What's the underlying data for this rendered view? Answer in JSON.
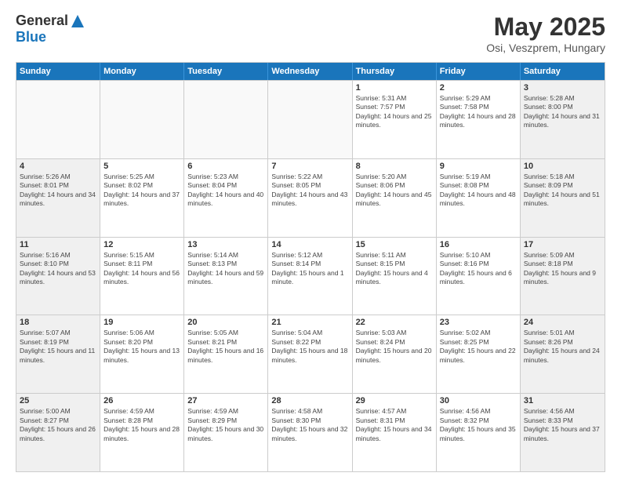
{
  "header": {
    "logo_general": "General",
    "logo_blue": "Blue",
    "month_title": "May 2025",
    "subtitle": "Osi, Veszprem, Hungary"
  },
  "days_of_week": [
    "Sunday",
    "Monday",
    "Tuesday",
    "Wednesday",
    "Thursday",
    "Friday",
    "Saturday"
  ],
  "rows": [
    {
      "cells": [
        {
          "day": "",
          "empty": true
        },
        {
          "day": "",
          "empty": true
        },
        {
          "day": "",
          "empty": true
        },
        {
          "day": "",
          "empty": true
        },
        {
          "day": "1",
          "sunrise": "Sunrise: 5:31 AM",
          "sunset": "Sunset: 7:57 PM",
          "daylight": "Daylight: 14 hours and 25 minutes."
        },
        {
          "day": "2",
          "sunrise": "Sunrise: 5:29 AM",
          "sunset": "Sunset: 7:58 PM",
          "daylight": "Daylight: 14 hours and 28 minutes."
        },
        {
          "day": "3",
          "sunrise": "Sunrise: 5:28 AM",
          "sunset": "Sunset: 8:00 PM",
          "daylight": "Daylight: 14 hours and 31 minutes.",
          "shaded": true
        }
      ]
    },
    {
      "cells": [
        {
          "day": "4",
          "sunrise": "Sunrise: 5:26 AM",
          "sunset": "Sunset: 8:01 PM",
          "daylight": "Daylight: 14 hours and 34 minutes.",
          "shaded": true
        },
        {
          "day": "5",
          "sunrise": "Sunrise: 5:25 AM",
          "sunset": "Sunset: 8:02 PM",
          "daylight": "Daylight: 14 hours and 37 minutes."
        },
        {
          "day": "6",
          "sunrise": "Sunrise: 5:23 AM",
          "sunset": "Sunset: 8:04 PM",
          "daylight": "Daylight: 14 hours and 40 minutes."
        },
        {
          "day": "7",
          "sunrise": "Sunrise: 5:22 AM",
          "sunset": "Sunset: 8:05 PM",
          "daylight": "Daylight: 14 hours and 43 minutes."
        },
        {
          "day": "8",
          "sunrise": "Sunrise: 5:20 AM",
          "sunset": "Sunset: 8:06 PM",
          "daylight": "Daylight: 14 hours and 45 minutes."
        },
        {
          "day": "9",
          "sunrise": "Sunrise: 5:19 AM",
          "sunset": "Sunset: 8:08 PM",
          "daylight": "Daylight: 14 hours and 48 minutes."
        },
        {
          "day": "10",
          "sunrise": "Sunrise: 5:18 AM",
          "sunset": "Sunset: 8:09 PM",
          "daylight": "Daylight: 14 hours and 51 minutes.",
          "shaded": true
        }
      ]
    },
    {
      "cells": [
        {
          "day": "11",
          "sunrise": "Sunrise: 5:16 AM",
          "sunset": "Sunset: 8:10 PM",
          "daylight": "Daylight: 14 hours and 53 minutes.",
          "shaded": true
        },
        {
          "day": "12",
          "sunrise": "Sunrise: 5:15 AM",
          "sunset": "Sunset: 8:11 PM",
          "daylight": "Daylight: 14 hours and 56 minutes."
        },
        {
          "day": "13",
          "sunrise": "Sunrise: 5:14 AM",
          "sunset": "Sunset: 8:13 PM",
          "daylight": "Daylight: 14 hours and 59 minutes."
        },
        {
          "day": "14",
          "sunrise": "Sunrise: 5:12 AM",
          "sunset": "Sunset: 8:14 PM",
          "daylight": "Daylight: 15 hours and 1 minute."
        },
        {
          "day": "15",
          "sunrise": "Sunrise: 5:11 AM",
          "sunset": "Sunset: 8:15 PM",
          "daylight": "Daylight: 15 hours and 4 minutes."
        },
        {
          "day": "16",
          "sunrise": "Sunrise: 5:10 AM",
          "sunset": "Sunset: 8:16 PM",
          "daylight": "Daylight: 15 hours and 6 minutes."
        },
        {
          "day": "17",
          "sunrise": "Sunrise: 5:09 AM",
          "sunset": "Sunset: 8:18 PM",
          "daylight": "Daylight: 15 hours and 9 minutes.",
          "shaded": true
        }
      ]
    },
    {
      "cells": [
        {
          "day": "18",
          "sunrise": "Sunrise: 5:07 AM",
          "sunset": "Sunset: 8:19 PM",
          "daylight": "Daylight: 15 hours and 11 minutes.",
          "shaded": true
        },
        {
          "day": "19",
          "sunrise": "Sunrise: 5:06 AM",
          "sunset": "Sunset: 8:20 PM",
          "daylight": "Daylight: 15 hours and 13 minutes."
        },
        {
          "day": "20",
          "sunrise": "Sunrise: 5:05 AM",
          "sunset": "Sunset: 8:21 PM",
          "daylight": "Daylight: 15 hours and 16 minutes."
        },
        {
          "day": "21",
          "sunrise": "Sunrise: 5:04 AM",
          "sunset": "Sunset: 8:22 PM",
          "daylight": "Daylight: 15 hours and 18 minutes."
        },
        {
          "day": "22",
          "sunrise": "Sunrise: 5:03 AM",
          "sunset": "Sunset: 8:24 PM",
          "daylight": "Daylight: 15 hours and 20 minutes."
        },
        {
          "day": "23",
          "sunrise": "Sunrise: 5:02 AM",
          "sunset": "Sunset: 8:25 PM",
          "daylight": "Daylight: 15 hours and 22 minutes."
        },
        {
          "day": "24",
          "sunrise": "Sunrise: 5:01 AM",
          "sunset": "Sunset: 8:26 PM",
          "daylight": "Daylight: 15 hours and 24 minutes.",
          "shaded": true
        }
      ]
    },
    {
      "cells": [
        {
          "day": "25",
          "sunrise": "Sunrise: 5:00 AM",
          "sunset": "Sunset: 8:27 PM",
          "daylight": "Daylight: 15 hours and 26 minutes.",
          "shaded": true
        },
        {
          "day": "26",
          "sunrise": "Sunrise: 4:59 AM",
          "sunset": "Sunset: 8:28 PM",
          "daylight": "Daylight: 15 hours and 28 minutes."
        },
        {
          "day": "27",
          "sunrise": "Sunrise: 4:59 AM",
          "sunset": "Sunset: 8:29 PM",
          "daylight": "Daylight: 15 hours and 30 minutes."
        },
        {
          "day": "28",
          "sunrise": "Sunrise: 4:58 AM",
          "sunset": "Sunset: 8:30 PM",
          "daylight": "Daylight: 15 hours and 32 minutes."
        },
        {
          "day": "29",
          "sunrise": "Sunrise: 4:57 AM",
          "sunset": "Sunset: 8:31 PM",
          "daylight": "Daylight: 15 hours and 34 minutes."
        },
        {
          "day": "30",
          "sunrise": "Sunrise: 4:56 AM",
          "sunset": "Sunset: 8:32 PM",
          "daylight": "Daylight: 15 hours and 35 minutes."
        },
        {
          "day": "31",
          "sunrise": "Sunrise: 4:56 AM",
          "sunset": "Sunset: 8:33 PM",
          "daylight": "Daylight: 15 hours and 37 minutes.",
          "shaded": true
        }
      ]
    }
  ]
}
